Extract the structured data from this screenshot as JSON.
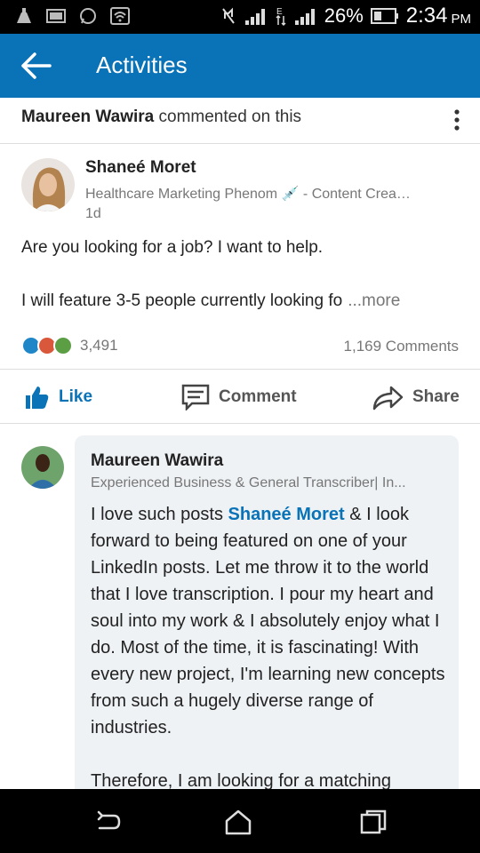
{
  "status_bar": {
    "battery": "26%",
    "time": "2:34",
    "ampm": "PM"
  },
  "app_bar": {
    "title": "Activities"
  },
  "activity": {
    "actor": "Maureen Wawira",
    "action": "commented on this"
  },
  "post": {
    "author": "Shaneé Moret",
    "headline": "Healthcare Marketing Phenom 💉 - Content Crea…",
    "age": "1d",
    "line1": "Are you looking for a job? I want to help.",
    "line2": "I will feature 3-5 people currently looking fo",
    "more": "...more",
    "reaction_count": "3,491",
    "comments_count": "1,169 Comments"
  },
  "actions": {
    "like": "Like",
    "comment": "Comment",
    "share": "Share"
  },
  "comment": {
    "author": "Maureen Wawira",
    "headline": "Experienced Business & General Transcriber| In...",
    "text_before": "I love such posts ",
    "mention": "Shaneé Moret",
    "text_after": " & I look forward to being featured on one of your LinkedIn posts. Let me throw it to the world that I love transcription. I pour my heart and soul into my work & I absolutely enjoy what I do. Most of the time, it is fascinating! With every new project, I'm learning new concepts from such a hugely diverse range of industries.",
    "para2": "Therefore, I am looking for a matching"
  },
  "colors": {
    "brand": "#0a73b7",
    "muted": "#777777",
    "comment_bg": "#eef2f5"
  }
}
